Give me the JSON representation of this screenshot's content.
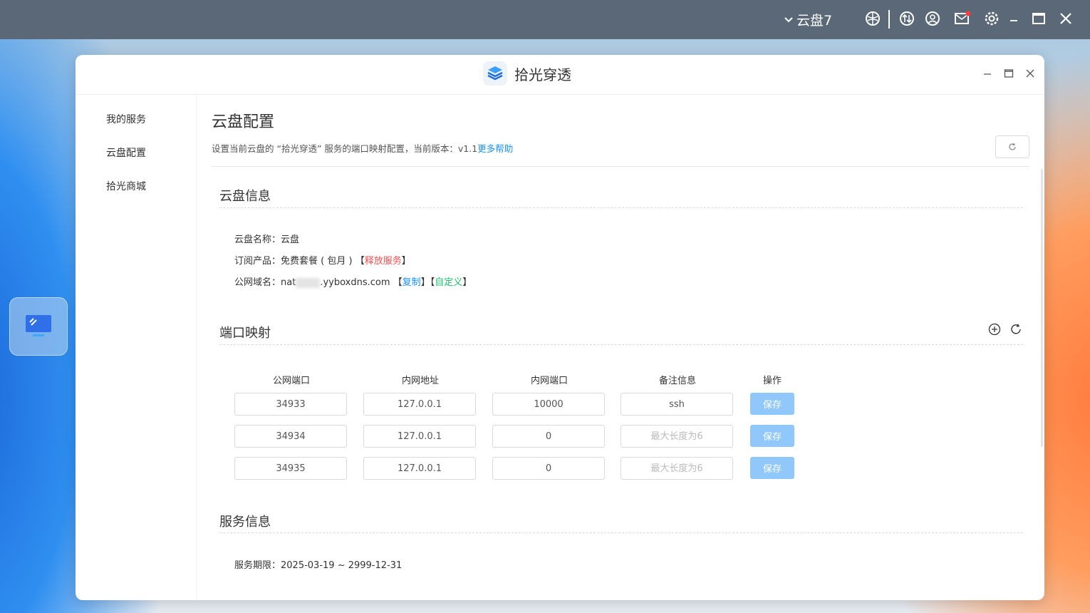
{
  "topbar": {
    "cloud_label": "云盘7"
  },
  "window": {
    "app_title": "拾光穿透"
  },
  "sidebar": {
    "items": [
      {
        "label": "我的服务"
      },
      {
        "label": "云盘配置"
      },
      {
        "label": "拾光商城"
      }
    ]
  },
  "main": {
    "title": "云盘配置",
    "desc": "设置当前云盘的 “拾光穿透” 服务的端口映射配置，当前版本：v1.1",
    "help_link": "更多帮助"
  },
  "cloud_info": {
    "title": "云盘信息",
    "name_label": "云盘名称：",
    "name_value": "云盘",
    "product_label": "订阅产品：",
    "product_value": "免费套餐 ( 包月 ) ",
    "release_link": "释放服务",
    "domain_label": "公网域名：",
    "domain_prefix": "nat",
    "domain_suffix": ".yyboxdns.com",
    "copy_link": "复制",
    "custom_link": "自定义",
    "bracket_open": "【",
    "bracket_close": "】"
  },
  "port_mapping": {
    "title": "端口映射",
    "headers": [
      "公网端口",
      "内网地址",
      "内网端口",
      "备注信息",
      "操作"
    ],
    "rows": [
      {
        "public_port": "34933",
        "address": "127.0.0.1",
        "inner_port": "10000",
        "note": "ssh",
        "note_placeholder": "最大长度为6",
        "save": "保存"
      },
      {
        "public_port": "34934",
        "address": "127.0.0.1",
        "inner_port": "0",
        "note": "",
        "note_placeholder": "最大长度为6",
        "save": "保存"
      },
      {
        "public_port": "34935",
        "address": "127.0.0.1",
        "inner_port": "0",
        "note": "",
        "note_placeholder": "最大长度为6",
        "save": "保存"
      }
    ]
  },
  "service_info": {
    "title": "服务信息",
    "period_label": "服务期限：",
    "period_value": "2025-03-19 ~ 2999-12-31"
  }
}
